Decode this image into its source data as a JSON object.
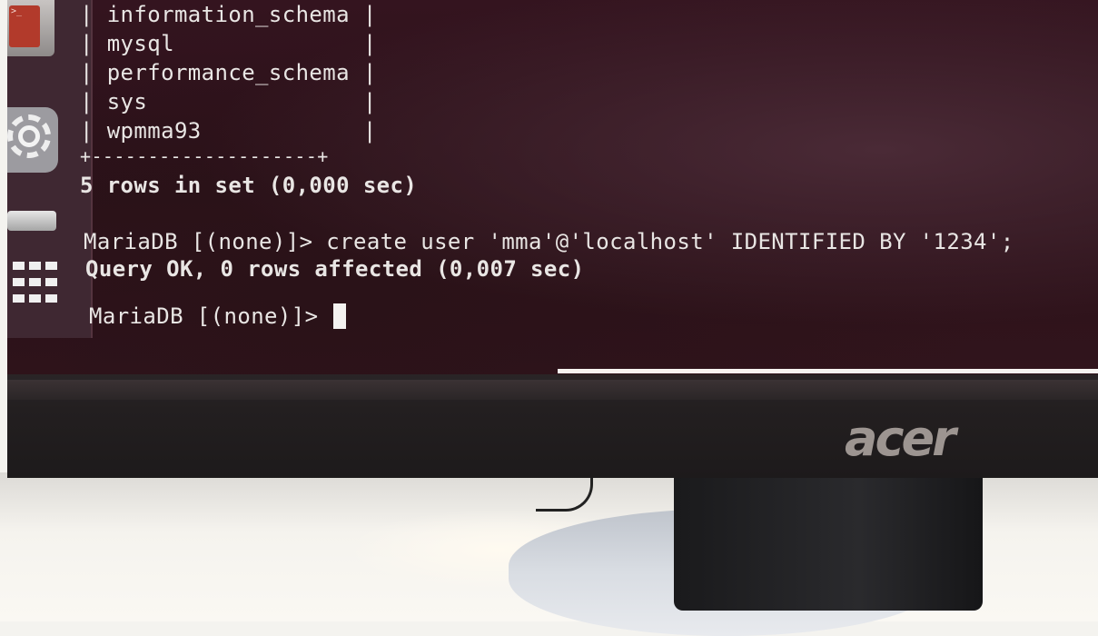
{
  "terminal": {
    "table_rows": [
      "| information_schema |",
      "| mysql              |",
      "| performance_schema |",
      "| sys                |",
      "| wpmma93            |",
      "+--------------------+"
    ],
    "result_line": "5 rows in set (0,000 sec)",
    "command_line": "MariaDB [(none)]> create user 'mma'@'localhost' IDENTIFIED BY '1234';",
    "query_ok_line": "Query OK, 0 rows affected (0,007 sec)",
    "prompt": "MariaDB [(none)]> "
  },
  "monitor": {
    "brand": "acer"
  },
  "launcher": {
    "icons": [
      "terminal-icon",
      "settings-icon",
      "drive-icon",
      "apps-grid-icon"
    ]
  }
}
